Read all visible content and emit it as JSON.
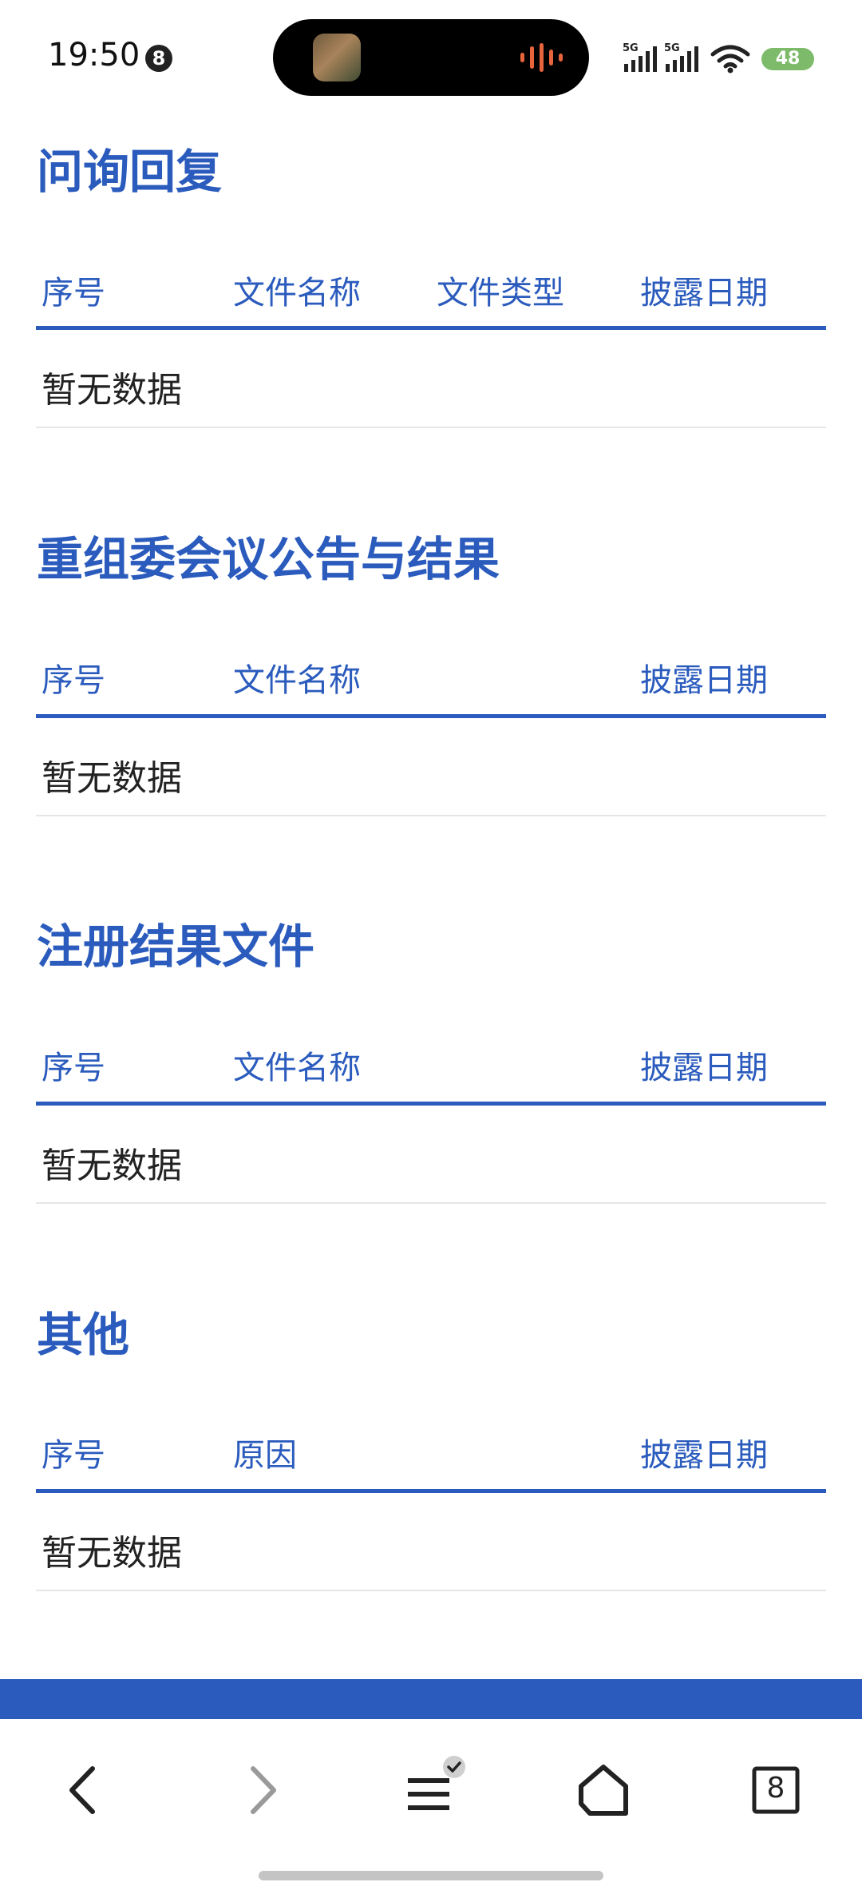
{
  "status_bar": {
    "time": "19:50",
    "notification_count": "8",
    "network_1": "5G",
    "network_2": "5G",
    "battery": "48"
  },
  "sections": [
    {
      "title": "问询回复",
      "headers": [
        "序号",
        "文件名称",
        "文件类型",
        "披露日期"
      ],
      "empty_text": "暂无数据"
    },
    {
      "title": "重组委会议公告与结果",
      "headers": [
        "序号",
        "文件名称",
        "披露日期"
      ],
      "empty_text": "暂无数据"
    },
    {
      "title": "注册结果文件",
      "headers": [
        "序号",
        "文件名称",
        "披露日期"
      ],
      "empty_text": "暂无数据"
    },
    {
      "title": "其他",
      "headers": [
        "序号",
        "原因",
        "披露日期"
      ],
      "empty_text": "暂无数据"
    }
  ],
  "browser_nav": {
    "tab_count": "8",
    "icons": [
      "back-icon",
      "forward-icon",
      "menu-icon",
      "home-icon",
      "tabs-icon"
    ]
  },
  "colors": {
    "accent": "#2a5bbd",
    "divider": "#e6e6e6",
    "text": "#222222"
  }
}
